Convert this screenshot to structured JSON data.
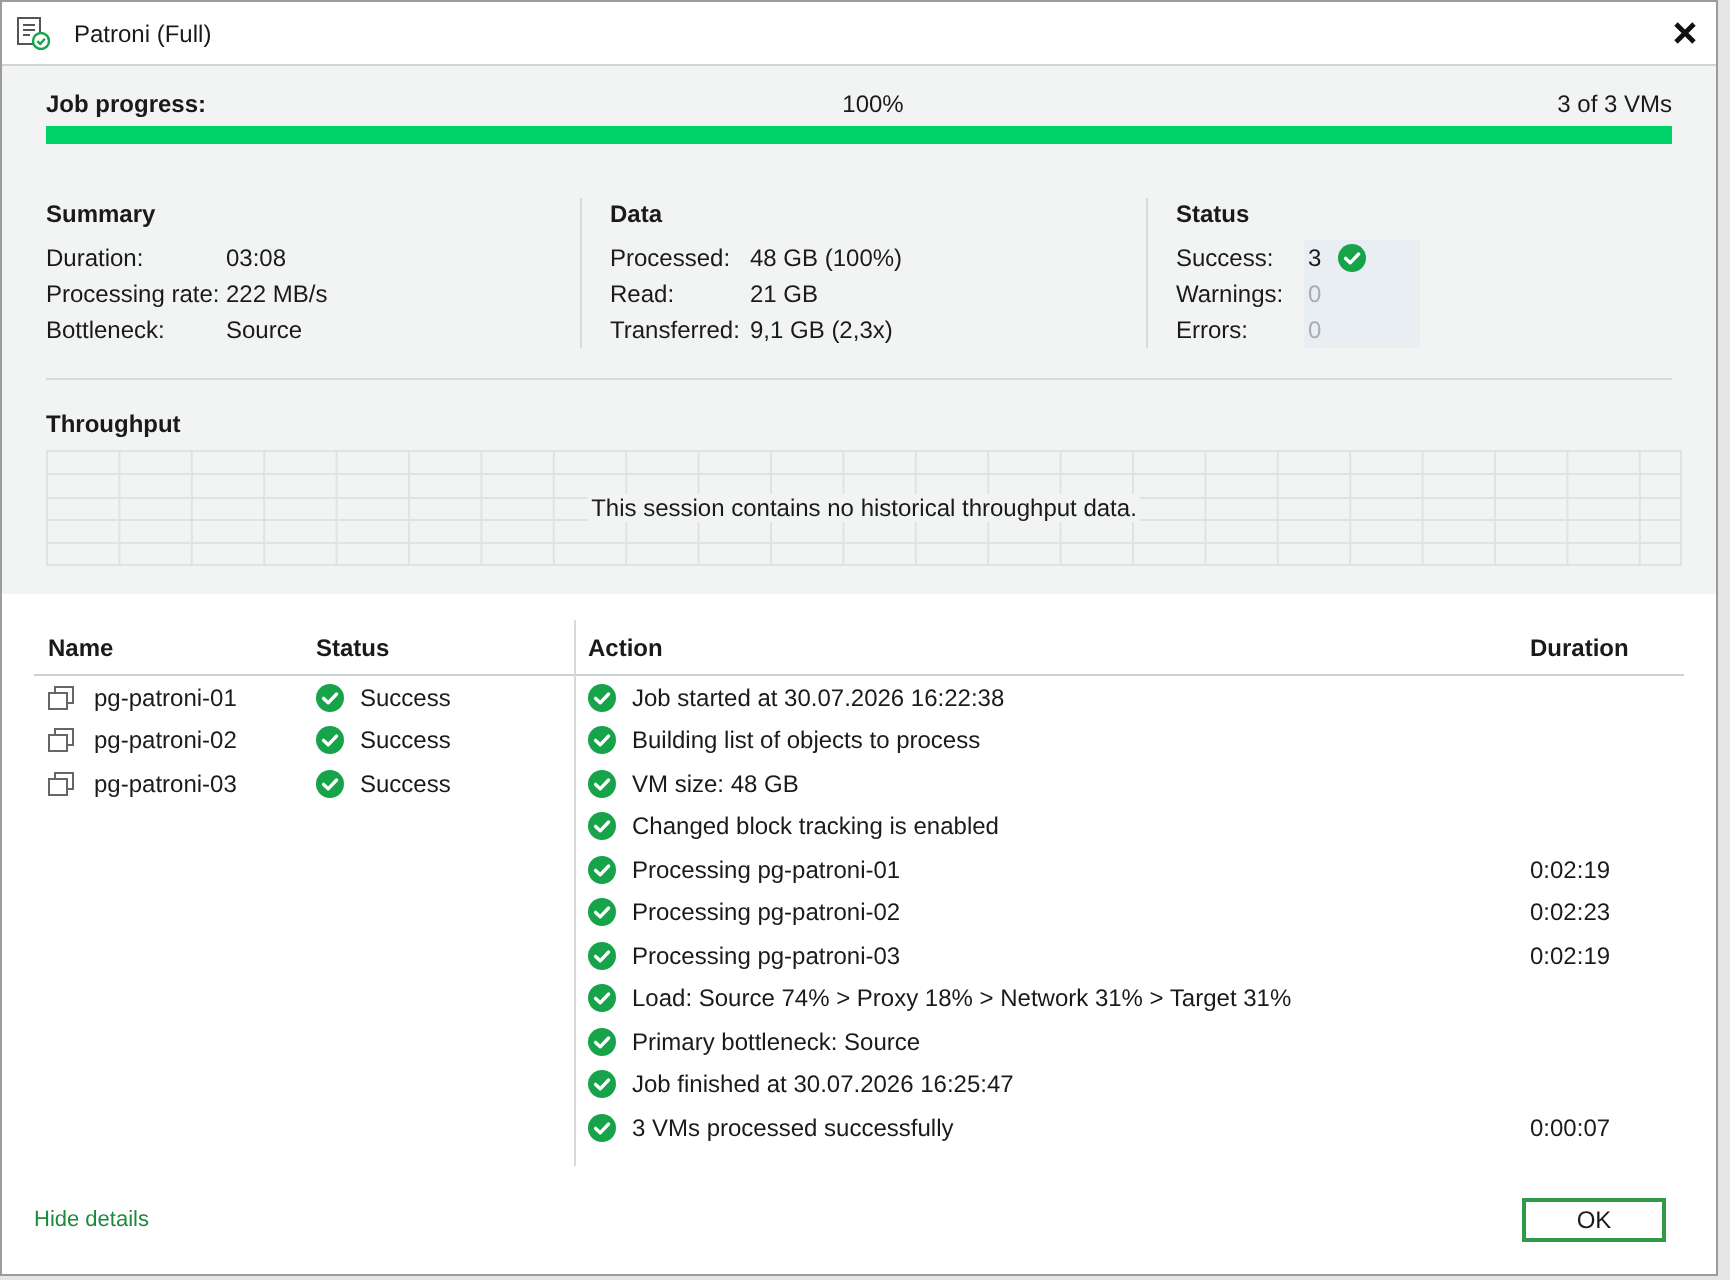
{
  "window": {
    "title": "Patroni (Full)"
  },
  "progress": {
    "label": "Job progress:",
    "percent": "100%",
    "count": "3 of 3 VMs",
    "level": 1
  },
  "sections": [
    {
      "title": "Summary",
      "fields": [
        {
          "label": "Duration:",
          "value": "03:08"
        },
        {
          "label": "Processing rate:",
          "value": "222 MB/s"
        },
        {
          "label": "Bottleneck:",
          "value": "Source"
        }
      ]
    },
    {
      "title": "Data",
      "fields": [
        {
          "label": "Processed:",
          "value": "48 GB (100%)"
        },
        {
          "label": "Read:",
          "value": "21 GB"
        },
        {
          "label": "Transferred:",
          "value": "9,1 GB (2,3x)"
        }
      ]
    },
    {
      "title": "Status",
      "fields": [
        {
          "label": "Success:",
          "value": "3",
          "kind": "success",
          "has_icon": true,
          "muted": false
        },
        {
          "label": "Warnings:",
          "value": "0",
          "kind": "warning",
          "has_icon": false,
          "muted": true
        },
        {
          "label": "Errors:",
          "value": "0",
          "kind": "error",
          "has_icon": false,
          "muted": true
        }
      ]
    }
  ],
  "throughput": {
    "title": "Throughput",
    "message": "This session contains no historical throughput data."
  },
  "objects": {
    "columns": [
      "Name",
      "Status"
    ],
    "rows": [
      {
        "name": "pg-patroni-01",
        "status": "Success",
        "kind": "success"
      },
      {
        "name": "pg-patroni-02",
        "status": "Success",
        "kind": "success"
      },
      {
        "name": "pg-patroni-03",
        "status": "Success",
        "kind": "success"
      }
    ]
  },
  "log": {
    "columns": [
      "Action",
      "Duration"
    ],
    "rows": [
      {
        "action": "Job started at 30.07.2026 16:22:38",
        "kind": "success"
      },
      {
        "action": "Building list of objects to process",
        "kind": "success"
      },
      {
        "action": "VM size: 48 GB",
        "kind": "success"
      },
      {
        "action": "Changed block tracking is enabled",
        "kind": "success"
      },
      {
        "action": "Processing pg-patroni-01",
        "duration": "0:02:19",
        "kind": "success"
      },
      {
        "action": "Processing pg-patroni-02",
        "duration": "0:02:23",
        "kind": "success"
      },
      {
        "action": "Processing pg-patroni-03",
        "duration": "0:02:19",
        "kind": "success"
      },
      {
        "action": "Load: Source 74% > Proxy 18% > Network 31% > Target 31%",
        "kind": "success"
      },
      {
        "action": "Primary bottleneck: Source",
        "kind": "success"
      },
      {
        "action": "Job finished at 30.07.2026 16:25:47",
        "kind": "success"
      },
      {
        "action": "3 VMs processed successfully",
        "duration": "0:00:07",
        "kind": "success"
      }
    ]
  },
  "footer": {
    "link": "Hide details",
    "button": "OK"
  }
}
